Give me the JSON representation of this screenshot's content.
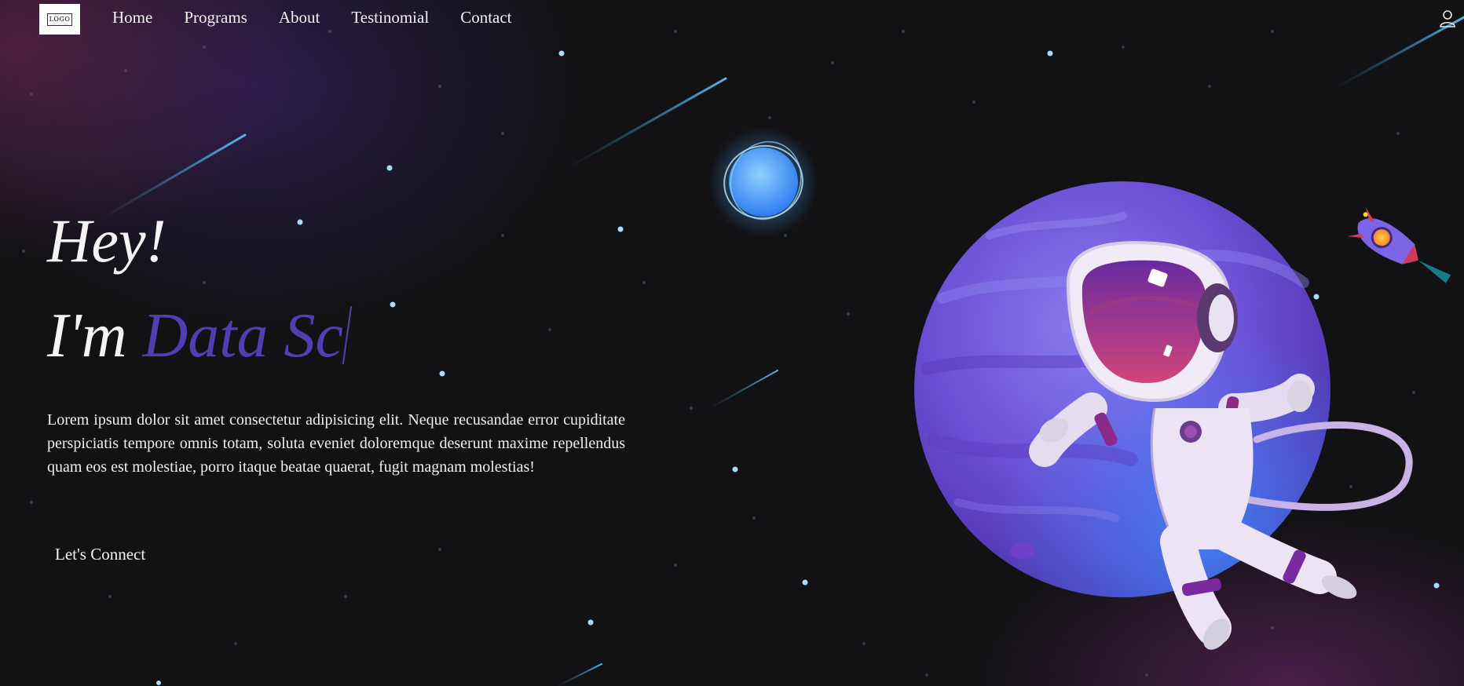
{
  "nav": {
    "logo_text": "LOGO",
    "links": [
      "Home",
      "Programs",
      "About",
      "Testinomial",
      "Contact"
    ],
    "user_icon": "user-icon"
  },
  "hero": {
    "greeting": "Hey!",
    "intro_prefix": "I'm",
    "typed_text": "Data Sc",
    "description": "Lorem ipsum dolor sit amet consectetur adipisicing elit. Neque recusandae error cupiditate perspiciatis tempore omnis totam, soluta eveniet doloremque deserunt maxime repellendus quam eos est molestiae, porro itaque beatae quaerat, fugit magnam molestias!",
    "cta_label": "Let's Connect"
  },
  "colors": {
    "background": "#121214",
    "accent": "#4f3fb2",
    "text": "#f4f4f4",
    "planet": "#6f4fd6"
  }
}
